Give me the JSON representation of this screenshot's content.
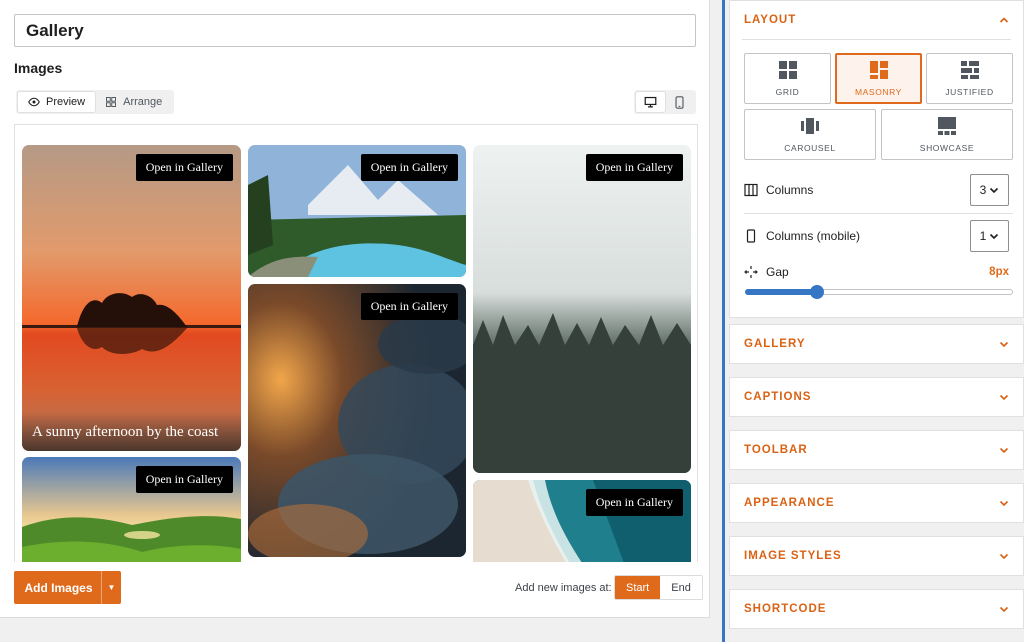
{
  "editor": {
    "title": "Gallery",
    "images_heading": "Images",
    "view_tabs": [
      {
        "label": "Preview",
        "active": true
      },
      {
        "label": "Arrange",
        "active": false
      }
    ],
    "gallery": {
      "open_label": "Open in Gallery",
      "tiles": [
        {
          "caption": "A sunny afternoon by the coast"
        },
        {
          "caption": ""
        },
        {
          "caption": ""
        },
        {
          "caption": ""
        },
        {
          "caption": ""
        },
        {
          "caption": ""
        }
      ]
    },
    "add_images_label": "Add Images",
    "add_new_at_label": "Add new images at:",
    "positions": [
      {
        "label": "Start",
        "active": true
      },
      {
        "label": "End",
        "active": false
      }
    ]
  },
  "sidebar": {
    "layout": {
      "title": "LAYOUT",
      "options": [
        {
          "label": "GRID",
          "icon": "grid-icon",
          "active": false
        },
        {
          "label": "MASONRY",
          "icon": "masonry-icon",
          "active": true
        },
        {
          "label": "JUSTIFIED",
          "icon": "justified-icon",
          "active": false
        },
        {
          "label": "CAROUSEL",
          "icon": "carousel-icon",
          "active": false
        },
        {
          "label": "SHOWCASE",
          "icon": "showcase-icon",
          "active": false
        }
      ],
      "columns_label": "Columns",
      "columns_value": "3",
      "columns_mobile_label": "Columns (mobile)",
      "columns_mobile_value": "1",
      "gap_label": "Gap",
      "gap_value": "8px",
      "gap_slider_fraction": 0.27
    },
    "sections": [
      "GALLERY",
      "CAPTIONS",
      "TOOLBAR",
      "APPEARANCE",
      "IMAGE STYLES",
      "SHORTCODE"
    ]
  },
  "colors": {
    "accent": "#e06a1c",
    "slider": "#3577c4"
  }
}
